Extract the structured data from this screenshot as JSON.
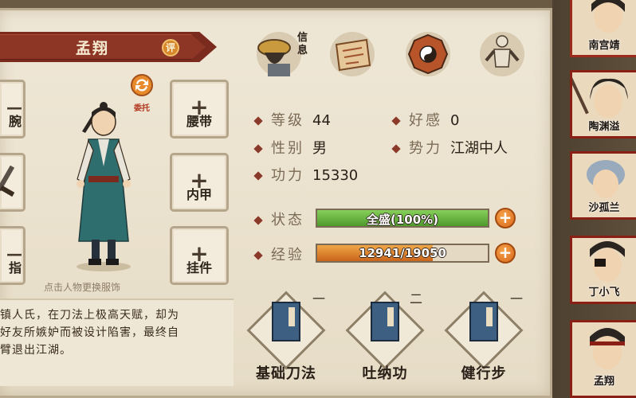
{
  "character": {
    "name": "孟翔",
    "rate_label": "评",
    "delegate_label": "委托",
    "tap_hint": "点击人物更换服饰",
    "bio_lines": [
      "镇人氏，在刀法上极高天赋，却为",
      "好友所嫉妒而被设计陷害，最终自",
      "臂退出江湖。"
    ]
  },
  "equipment": {
    "left": [
      "腕",
      "",
      "指"
    ],
    "right": [
      "腰带",
      "内甲",
      "挂件"
    ]
  },
  "top_icons": [
    {
      "name": "info",
      "label": "信息"
    },
    {
      "name": "scroll-map",
      "label": ""
    },
    {
      "name": "bagua",
      "label": ""
    },
    {
      "name": "body-meridian",
      "label": ""
    }
  ],
  "stats": {
    "level_label": "等级",
    "level_value": "44",
    "favor_label": "好感",
    "favor_value": "0",
    "gender_label": "性别",
    "gender_value": "男",
    "faction_label": "势力",
    "faction_value": "江湖中人",
    "power_label": "功力",
    "power_value": "15330"
  },
  "bars": {
    "status_label": "状态",
    "status_text": "全盛(100%)",
    "status_fraction": 1.0,
    "exp_label": "经验",
    "exp_text": "12941/19050",
    "exp_fraction": 0.679
  },
  "skills": [
    {
      "name": "基础刀法",
      "level": "一"
    },
    {
      "name": "吐纳功",
      "level": "二"
    },
    {
      "name": "健行步",
      "level": "一"
    }
  ],
  "roster": [
    "南宫靖",
    "陶渊溢",
    "沙孤兰",
    "丁小飞",
    "孟翔"
  ],
  "colors": {
    "status_bar": "#5fb23a",
    "exp_bar": "#e08a2a",
    "accent_red": "#8e3626"
  }
}
